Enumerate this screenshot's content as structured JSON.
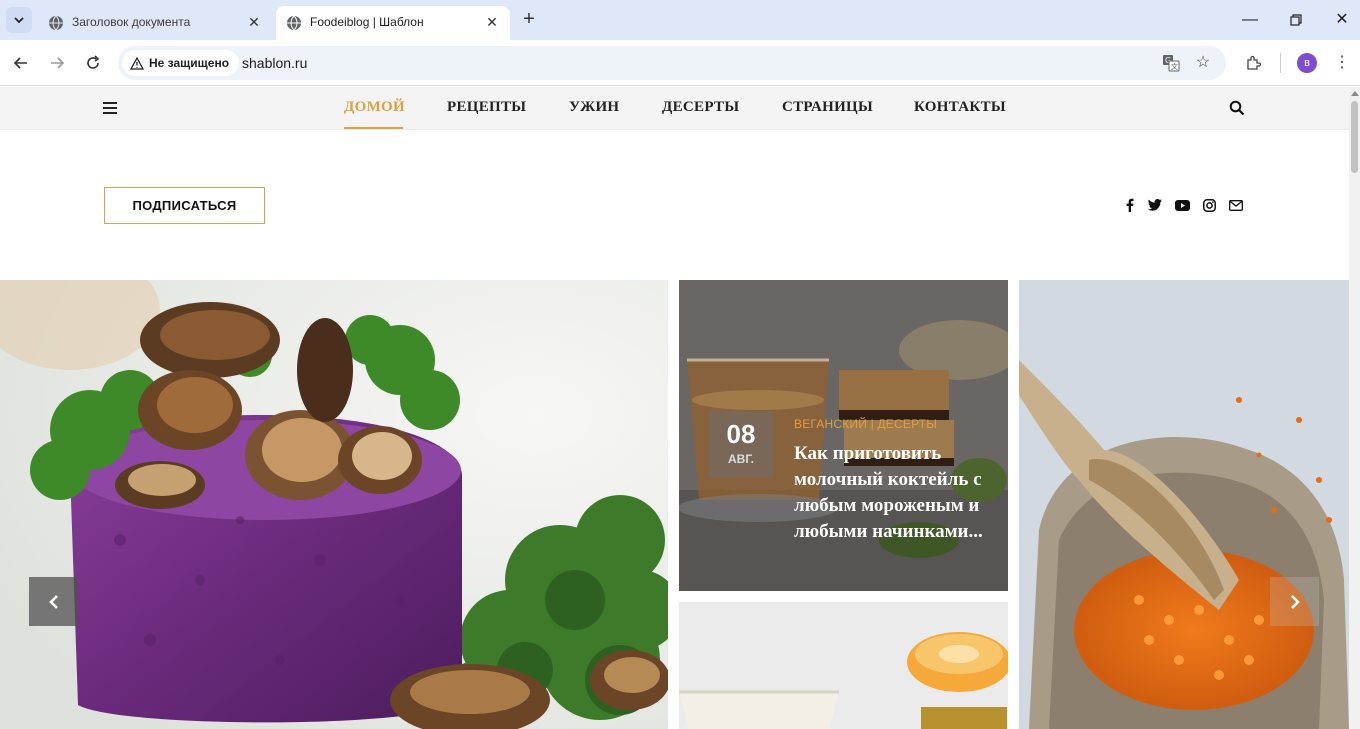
{
  "browser": {
    "tabs": [
      {
        "title": "Заголовок документа",
        "active": false
      },
      {
        "title": "Foodeiblog | Шаблон",
        "active": true
      }
    ],
    "security_label": "Не защищено",
    "url": "shablon.ru",
    "profile_initial": "в"
  },
  "nav": {
    "items": [
      {
        "label": "ДОМОЙ",
        "active": true
      },
      {
        "label": "РЕЦЕПТЫ",
        "active": false
      },
      {
        "label": "УЖИН",
        "active": false
      },
      {
        "label": "ДЕСЕРТЫ",
        "active": false
      },
      {
        "label": "СТРАНИЦЫ",
        "active": false
      },
      {
        "label": "КОНТАКТЫ",
        "active": false
      }
    ],
    "accent_color": "#e0a040"
  },
  "header": {
    "subscribe_label": "ПОДПИСАТЬСЯ",
    "social": [
      "facebook-icon",
      "twitter-icon",
      "youtube-icon",
      "instagram-icon",
      "envelope-icon"
    ]
  },
  "slider": {
    "featured_post": {
      "day": "08",
      "month": "АВГ.",
      "categories": "ВЕГАНСКИЙ  |  ДЕСЕРТЫ",
      "title": "Как приготовить молочный коктейль с любым мороженым и любыми начинками..."
    }
  }
}
